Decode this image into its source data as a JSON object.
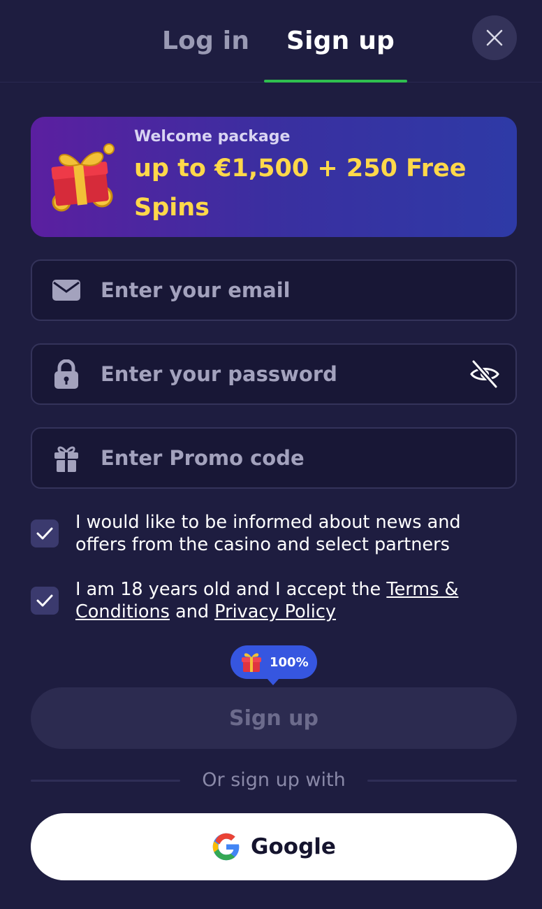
{
  "tabs": {
    "login": "Log in",
    "signup": "Sign up",
    "active": "signup"
  },
  "banner": {
    "subtitle": "Welcome package",
    "title": "up to €1,500 + 250 Free Spins"
  },
  "form": {
    "email_placeholder": "Enter your email",
    "password_placeholder": "Enter your password",
    "promo_placeholder": "Enter Promo code"
  },
  "consents": {
    "news_text": "I would like to be informed about news and offers from the casino and select partners",
    "news_checked": true,
    "age_prefix": "I am 18 years old and I accept the ",
    "terms_link": "Terms & Conditions",
    "age_and": " and ",
    "privacy_link": "Privacy Policy",
    "age_checked": true
  },
  "bonus_badge": {
    "percent": "100%"
  },
  "submit_label": "Sign up",
  "divider_text": "Or sign up with",
  "social": {
    "google_label": "Google"
  },
  "colors": {
    "background": "#1e1d40",
    "accent_green": "#2fbf4f",
    "promo_yellow": "#ffd84a",
    "badge_blue": "#3656e0",
    "checkbox": "#3b3a6e"
  },
  "icons": {
    "close": "close-icon",
    "email": "envelope-icon",
    "password": "lock-icon",
    "toggle": "eye-off-icon",
    "promo": "gift-icon",
    "check": "checkmark-icon",
    "google": "google-logo-icon"
  }
}
